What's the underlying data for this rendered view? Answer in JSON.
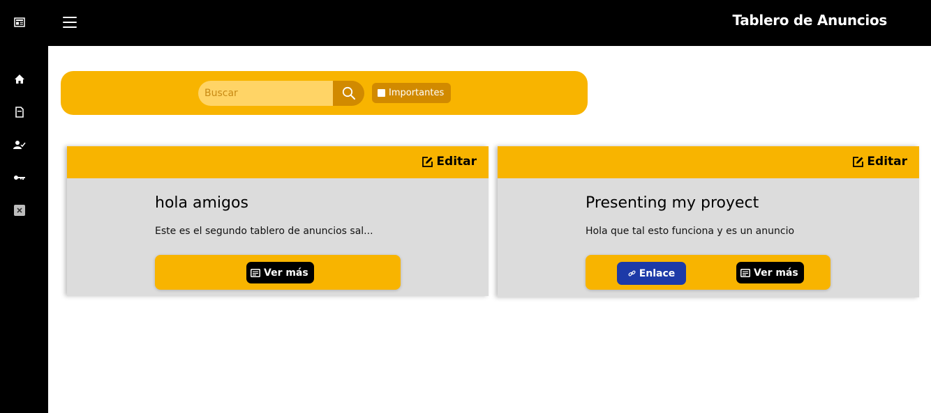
{
  "header": {
    "title": "Tablero de Anuncios"
  },
  "sidebar": {
    "items": [
      {
        "icon": "newspaper-icon"
      },
      {
        "icon": "home-icon"
      },
      {
        "icon": "document-icon"
      },
      {
        "icon": "user-check-icon"
      },
      {
        "icon": "key-icon"
      },
      {
        "icon": "close-box-icon"
      }
    ]
  },
  "search": {
    "placeholder": "Buscar",
    "value": "",
    "important_label": "Importantes"
  },
  "cards": [
    {
      "edit_label": "Editar",
      "title": "hola amigos",
      "description": "Este es el segundo tablero de anuncios sal...",
      "more_label": "Ver más"
    },
    {
      "edit_label": "Editar",
      "title": "Presenting my proyect",
      "description": "Hola que tal esto funciona y es un anuncio",
      "link_label": "Enlace",
      "more_label": "Ver más"
    }
  ],
  "colors": {
    "accent": "#f8b400",
    "accent_dark": "#d18a00",
    "link_button": "#1d3aa8",
    "card_body": "#dcdcdc"
  }
}
